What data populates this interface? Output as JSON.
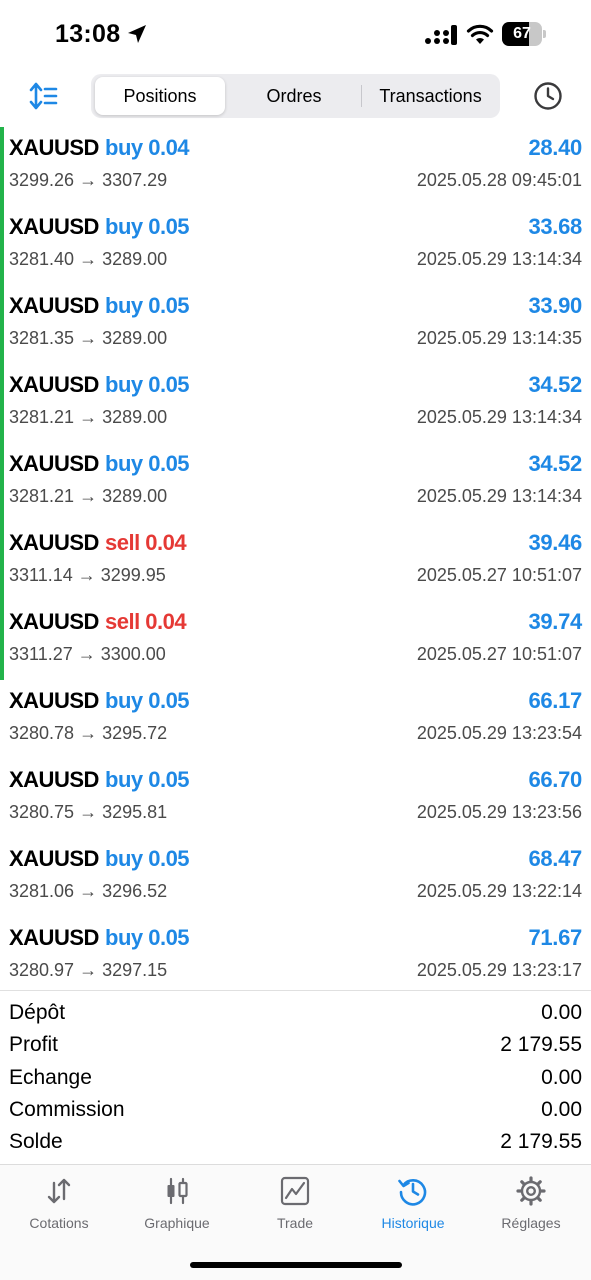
{
  "status_bar": {
    "time": "13:08",
    "battery": "67",
    "battery_level": 0.67
  },
  "toolbar": {
    "tabs": [
      {
        "label": "Positions",
        "active": true
      },
      {
        "label": "Ordres",
        "active": false
      },
      {
        "label": "Transactions",
        "active": false
      }
    ]
  },
  "trades": [
    {
      "symbol": "XAUUSD",
      "side": "buy 0.04",
      "type": "buy",
      "profit": "28.40",
      "prices": "3299.26 → 3307.29",
      "time": "2025.05.28 09:45:01",
      "highlight": true
    },
    {
      "symbol": "XAUUSD",
      "side": "buy 0.05",
      "type": "buy",
      "profit": "33.68",
      "prices": "3281.40 → 3289.00",
      "time": "2025.05.29 13:14:34",
      "highlight": true
    },
    {
      "symbol": "XAUUSD",
      "side": "buy 0.05",
      "type": "buy",
      "profit": "33.90",
      "prices": "3281.35 → 3289.00",
      "time": "2025.05.29 13:14:35",
      "highlight": true
    },
    {
      "symbol": "XAUUSD",
      "side": "buy 0.05",
      "type": "buy",
      "profit": "34.52",
      "prices": "3281.21 → 3289.00",
      "time": "2025.05.29 13:14:34",
      "highlight": true
    },
    {
      "symbol": "XAUUSD",
      "side": "buy 0.05",
      "type": "buy",
      "profit": "34.52",
      "prices": "3281.21 → 3289.00",
      "time": "2025.05.29 13:14:34",
      "highlight": true
    },
    {
      "symbol": "XAUUSD",
      "side": "sell 0.04",
      "type": "sell",
      "profit": "39.46",
      "prices": "3311.14 → 3299.95",
      "time": "2025.05.27 10:51:07",
      "highlight": true
    },
    {
      "symbol": "XAUUSD",
      "side": "sell 0.04",
      "type": "sell",
      "profit": "39.74",
      "prices": "3311.27 → 3300.00",
      "time": "2025.05.27 10:51:07",
      "highlight": true
    },
    {
      "symbol": "XAUUSD",
      "side": "buy 0.05",
      "type": "buy",
      "profit": "66.17",
      "prices": "3280.78 → 3295.72",
      "time": "2025.05.29 13:23:54",
      "highlight": false
    },
    {
      "symbol": "XAUUSD",
      "side": "buy 0.05",
      "type": "buy",
      "profit": "66.70",
      "prices": "3280.75 → 3295.81",
      "time": "2025.05.29 13:23:56",
      "highlight": false
    },
    {
      "symbol": "XAUUSD",
      "side": "buy 0.05",
      "type": "buy",
      "profit": "68.47",
      "prices": "3281.06 → 3296.52",
      "time": "2025.05.29 13:22:14",
      "highlight": false
    },
    {
      "symbol": "XAUUSD",
      "side": "buy 0.05",
      "type": "buy",
      "profit": "71.67",
      "prices": "3280.97 → 3297.15",
      "time": "2025.05.29 13:23:17",
      "highlight": false
    }
  ],
  "summary": [
    {
      "label": "Dépôt",
      "value": "0.00"
    },
    {
      "label": "Profit",
      "value": "2 179.55"
    },
    {
      "label": "Echange",
      "value": "0.00"
    },
    {
      "label": "Commission",
      "value": "0.00"
    },
    {
      "label": "Solde",
      "value": "2 179.55"
    }
  ],
  "tabbar": {
    "tabs": [
      {
        "label": "Cotations",
        "icon": "quotes-arrows-icon",
        "active": false
      },
      {
        "label": "Graphique",
        "icon": "candlestick-chart-icon",
        "active": false
      },
      {
        "label": "Trade",
        "icon": "trade-chart-icon",
        "active": false
      },
      {
        "label": "Historique",
        "icon": "history-clock-icon",
        "active": true
      },
      {
        "label": "Réglages",
        "icon": "gear-icon",
        "active": false
      }
    ]
  },
  "colors": {
    "accent": "#1e88e5",
    "sell": "#e53935",
    "highlight_bar": "#22b34a",
    "muted": "#6b6b70"
  }
}
